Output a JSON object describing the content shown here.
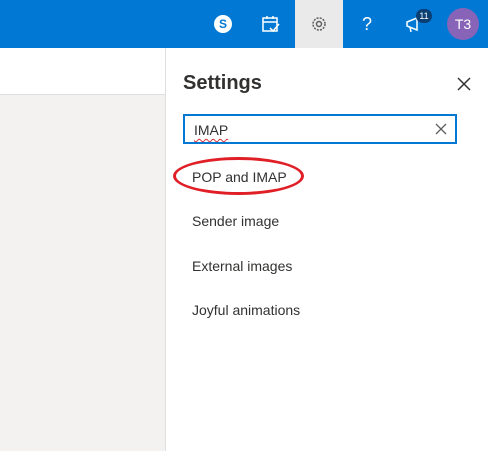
{
  "toolbar": {
    "skype_label": "S",
    "help_label": "?",
    "notification_count": "11",
    "avatar_initials": "T3"
  },
  "settings": {
    "title": "Settings",
    "search_value": "IMAP",
    "results": [
      "POP and IMAP",
      "Sender image",
      "External images",
      "Joyful animations"
    ]
  },
  "colors": {
    "topbar": "#0078d4",
    "avatar": "#8764b8",
    "highlight_oval": "#e01e26"
  }
}
